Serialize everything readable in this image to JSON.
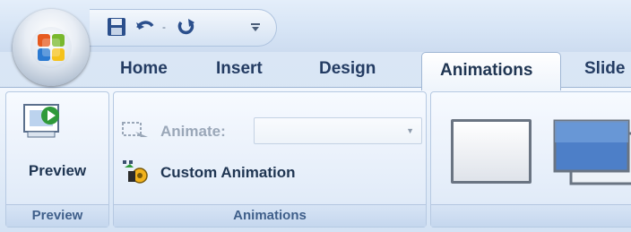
{
  "tabs": [
    {
      "label": "Home"
    },
    {
      "label": "Insert"
    },
    {
      "label": "Design"
    },
    {
      "label": "Animations"
    },
    {
      "label": "Slide"
    }
  ],
  "active_tab": "Animations",
  "icons": {
    "office_button": "office-logo-icon",
    "save": "save-icon",
    "undo": "undo-icon",
    "undo_dropdown": "chevron-down-icon",
    "redo": "redo-icon",
    "customize_qat": "customize-toolbar-icon",
    "preview": "preview-slide-icon",
    "animate": "animate-icon",
    "custom_animation": "custom-animation-icon",
    "transition_1": "transition-none-thumbnail-icon",
    "transition_2": "transition-fade-thumbnail-icon"
  },
  "preview_group": {
    "button_label": "Preview",
    "group_label": "Preview"
  },
  "animations_group": {
    "animate_label": "Animate:",
    "animate_value": "",
    "custom_animation_label": "Custom Animation",
    "group_label": "Animations"
  },
  "colors": {
    "tab_text": "#243c63",
    "ribbon_bg": "#dfe9f5",
    "group_label_text": "#3f5f8a"
  }
}
